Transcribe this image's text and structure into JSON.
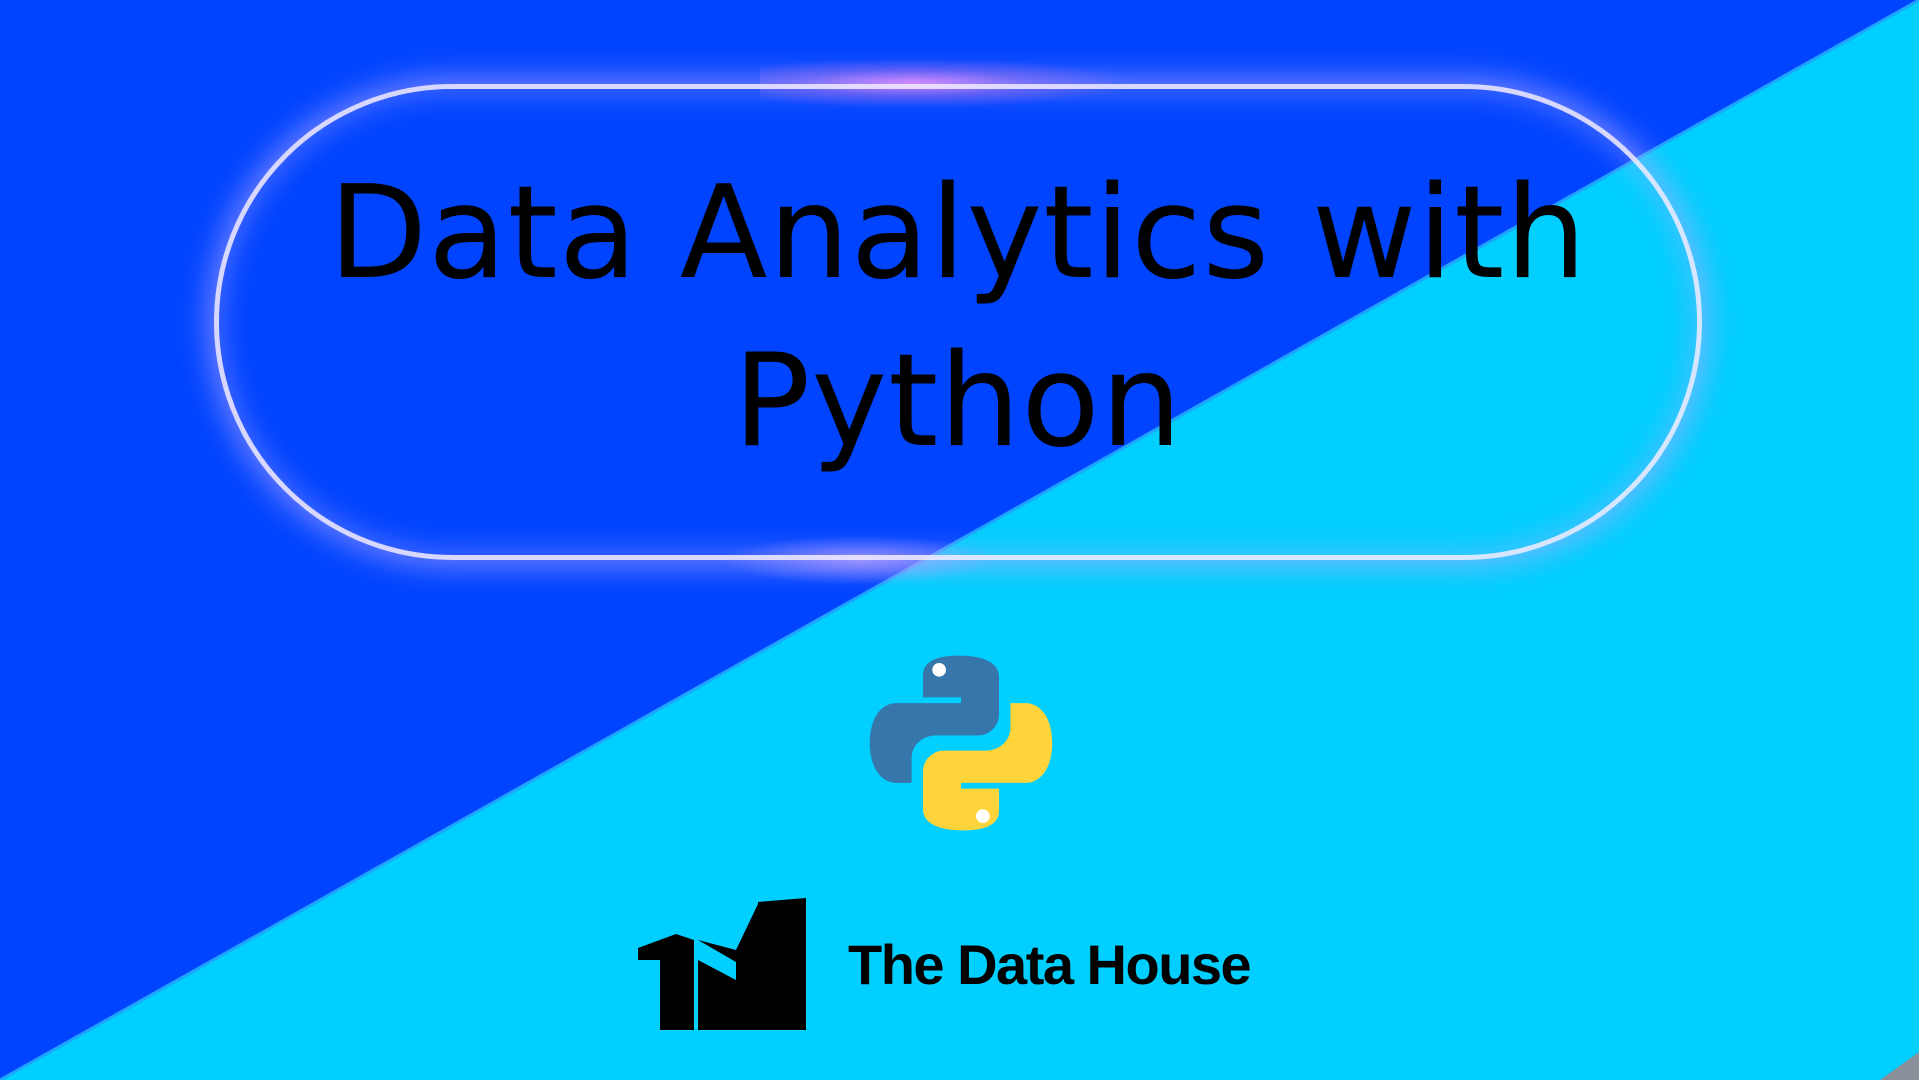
{
  "title": {
    "line1": "Data Analytics with",
    "line2": "Python"
  },
  "icons": {
    "python_logo": "python-logo-icon",
    "brand_logo": "the-data-house-logo-icon"
  },
  "brand": {
    "name": "The Data House"
  },
  "colors": {
    "background_blue": "#0044ff",
    "background_cyan": "#00cfff",
    "pill_outline": "#eee8ff",
    "python_blue": "#3776ab",
    "python_yellow": "#ffd43b"
  }
}
